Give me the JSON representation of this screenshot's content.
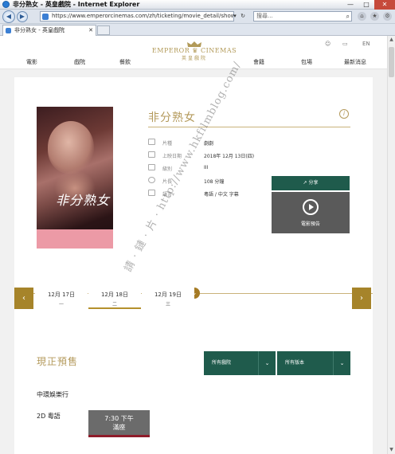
{
  "window": {
    "title": "非分熟女 - 英皇戲院 - Internet Explorer",
    "controls": [
      "—",
      "□",
      "✕"
    ]
  },
  "browser": {
    "url": "https://www.emperorcinemas.com/zh/ticketing/movie_detail/showing/404",
    "search_placeholder": "搜尋...",
    "tab_label": "非分熟女 - 英皇戲院"
  },
  "site": {
    "logo_en": "EMPEROR ♛ CINEMAS",
    "logo_zh": "英皇戲院",
    "nav": [
      "電影",
      "戲院",
      "餐飲",
      "會籍",
      "包場",
      "最新消息"
    ],
    "lang": "EN"
  },
  "movie": {
    "title": "非分熟女",
    "poster_title": "非分熟女",
    "info": [
      {
        "icon": "genre-icon",
        "label": "片種",
        "value": "劇劇"
      },
      {
        "icon": "calendar-icon",
        "label": "上映日期",
        "value": "2018年 12月 13日(四)"
      },
      {
        "icon": "rating-icon",
        "label": "級別",
        "value": "III"
      },
      {
        "icon": "clock-icon",
        "label": "片長",
        "value": "108 分鐘"
      },
      {
        "icon": "language-icon",
        "label": "語言",
        "value": "粵語 / 中文 字幕"
      }
    ],
    "share_label": "分享",
    "trailer_label": "電影預告"
  },
  "dates": {
    "tabs": [
      {
        "date": "12月 17日",
        "weekday": "一"
      },
      {
        "date": "12月 18日",
        "weekday": "二"
      },
      {
        "date": "12月 19日",
        "weekday": "三"
      }
    ],
    "active_index": 1
  },
  "showtimes": {
    "section_title": "現正預售",
    "cinema_filter": "所有戲院",
    "version_filter": "所有版本",
    "cinema_name": "中環娛樂行",
    "format": "2D 粵語",
    "slots": [
      {
        "time": "7:30 下午",
        "status": "滿座"
      }
    ]
  },
  "watermark": "請 · 鏈 · 片 · http://www.hkfilmblog.com/",
  "colors": {
    "gold": "#b49a5c",
    "green": "#1f5b4c",
    "soldout": "#8e1c2a"
  }
}
